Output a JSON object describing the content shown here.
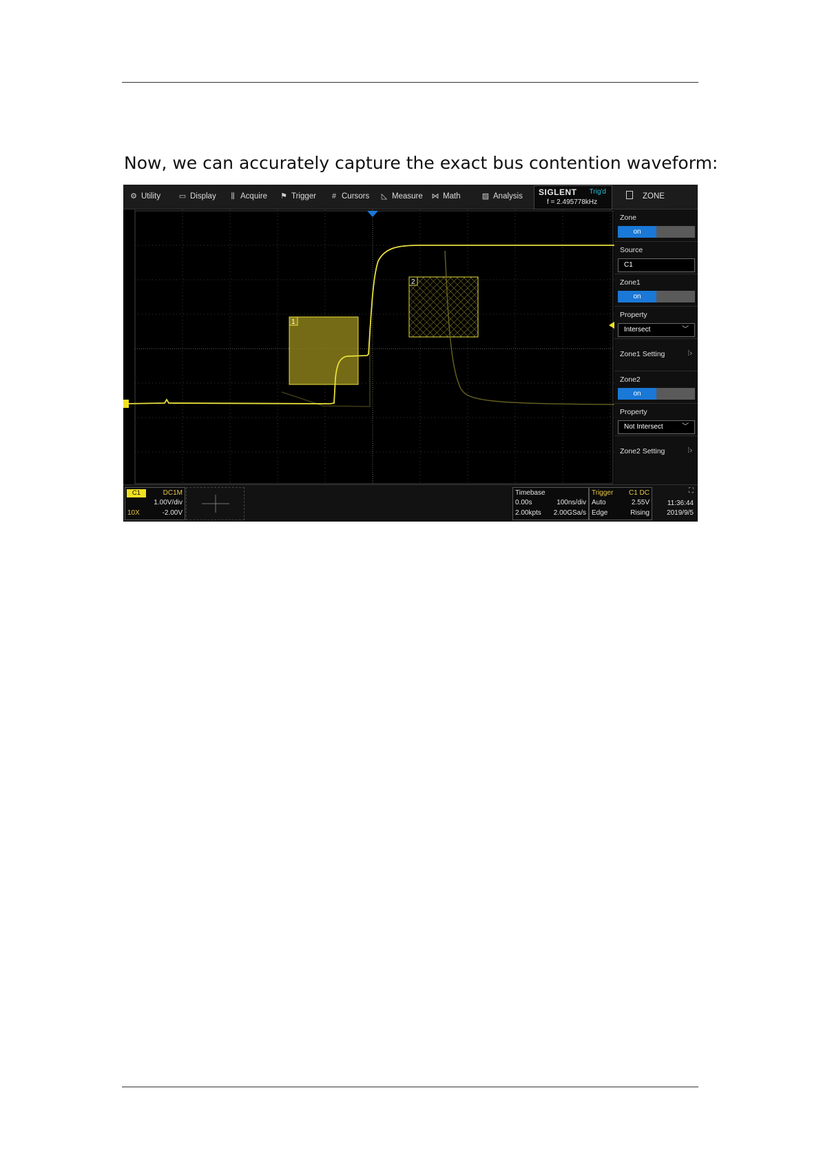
{
  "caption": "Now, we can accurately capture the exact bus contention waveform:",
  "menu": [
    {
      "label": "Utility",
      "icon": "gear-icon"
    },
    {
      "label": "Display",
      "icon": "monitor-icon"
    },
    {
      "label": "Acquire",
      "icon": "acquire-icon"
    },
    {
      "label": "Trigger",
      "icon": "flag-icon"
    },
    {
      "label": "Cursors",
      "icon": "hash-icon"
    },
    {
      "label": "Measure",
      "icon": "measure-icon"
    },
    {
      "label": "Math",
      "icon": "math-icon"
    },
    {
      "label": "Analysis",
      "icon": "analysis-icon"
    }
  ],
  "brand": {
    "name": "SIGLENT",
    "status": "Trig'd",
    "frequency": "f = 2.495778kHz"
  },
  "panel": {
    "title": "ZONE",
    "zone_label": "Zone",
    "zone_state": "on",
    "source_label": "Source",
    "source_value": "C1",
    "zone1_label": "Zone1",
    "zone1_state": "on",
    "property1_label": "Property",
    "property1_value": "Intersect",
    "zone1_setting": "Zone1 Setting",
    "zone2_label": "Zone2",
    "zone2_state": "on",
    "property2_label": "Property",
    "property2_value": "Not Intersect",
    "zone2_setting": "Zone2 Setting"
  },
  "zones": {
    "zone1_number": "1",
    "zone2_number": "2"
  },
  "channel": {
    "name": "C1",
    "coupling": "DC1M",
    "scale": "1.00V/div",
    "probe": "10X",
    "offset": "-2.00V"
  },
  "timebase": {
    "label": "Timebase",
    "delay": "0.00s",
    "scale": "100ns/div",
    "points": "2.00kpts",
    "sample_rate": "2.00GSa/s"
  },
  "trigger": {
    "label": "Trigger",
    "source": "C1 DC",
    "mode": "Auto",
    "level": "2.55V",
    "type": "Edge",
    "slope": "Rising"
  },
  "clock": {
    "time": "11:36:44",
    "date": "2019/9/5"
  },
  "colors": {
    "trace": "#e8e03a",
    "zone_fill": "#8a7e1a",
    "accent_blue": "#1a78d6",
    "trig_status": "#29c3d6"
  }
}
